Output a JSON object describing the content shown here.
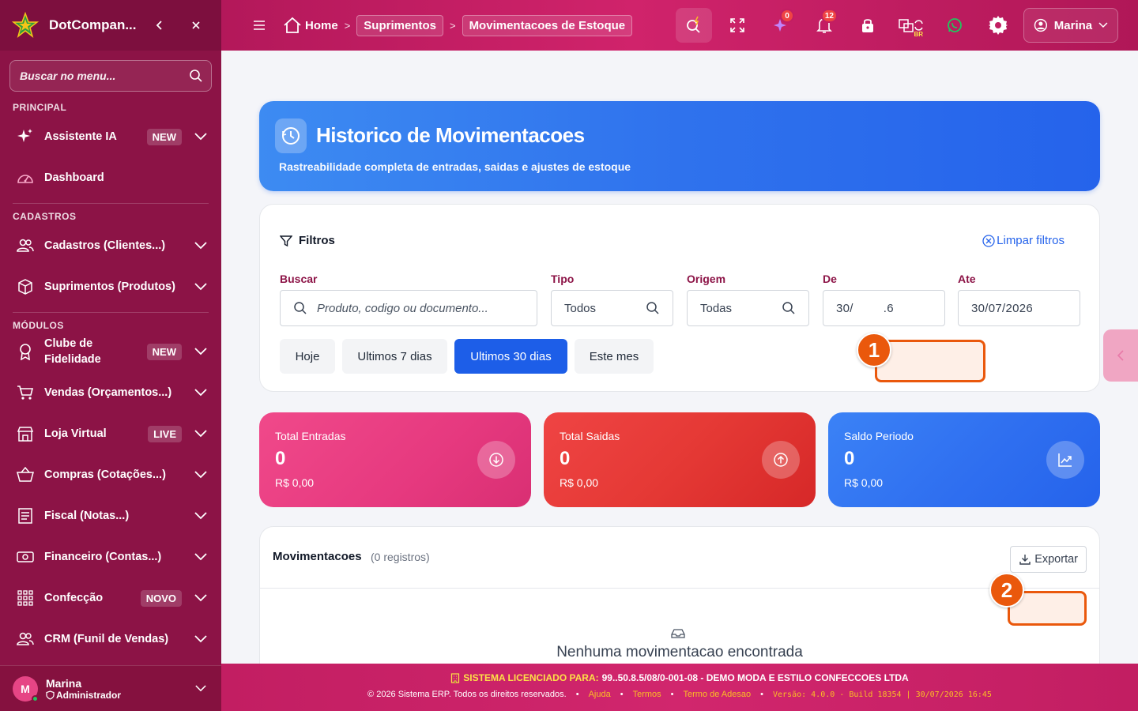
{
  "colors": {
    "sidebar": "#8c1346",
    "topbar": "#c21e62",
    "hero_blue": "#2f72ed",
    "stat_pink": "#e6397f",
    "stat_red": "#e53935",
    "stat_blue": "#2f6ff0",
    "accent_blue": "#2563eb",
    "callout_orange": "#ea580c"
  },
  "sidebar": {
    "brand": "DotCompan...",
    "search_placeholder": "Buscar no menu...",
    "sections": {
      "principal": "PRINCIPAL",
      "cadastros": "CADASTROS",
      "modulos": "MÓDULOS"
    },
    "items": {
      "assistente": {
        "label": "Assistente IA",
        "badge": "NEW"
      },
      "dashboard": {
        "label": "Dashboard"
      },
      "cadastros": {
        "label": "Cadastros (Clientes...)"
      },
      "suprimentos": {
        "label": "Suprimentos (Produtos)"
      },
      "clube_l1": "Clube de",
      "clube_l2": "Fidelidade",
      "clube_badge": "NEW",
      "vendas": {
        "label": "Vendas (Orçamentos...)"
      },
      "loja": {
        "label": "Loja Virtual",
        "badge": "LIVE"
      },
      "compras": {
        "label": "Compras (Cotações...)"
      },
      "fiscal": {
        "label": "Fiscal (Notas...)"
      },
      "financeiro": {
        "label": "Financeiro (Contas...)"
      },
      "confeccao": {
        "label": "Confecção",
        "badge": "NOVO"
      },
      "crm": {
        "label": "CRM (Funil de Vendas)"
      }
    },
    "user": {
      "initial": "M",
      "name": "Marina",
      "role": "Administrador"
    }
  },
  "topbar": {
    "breadcrumb": {
      "home": "Home",
      "level1": "Suprimentos",
      "current": "Movimentacoes de Estoque"
    },
    "badges": {
      "ai": "0",
      "notifications": "12"
    },
    "lang_tag": "BR",
    "user_name": "Marina"
  },
  "hero": {
    "title": "Historico de Movimentacoes",
    "subtitle": "Rastreabilidade completa de entradas, saidas e ajustes de estoque"
  },
  "filters": {
    "title": "Filtros",
    "clear": "Limpar filtros",
    "buscar": {
      "label": "Buscar",
      "placeholder": "Produto, codigo ou documento..."
    },
    "tipo": {
      "label": "Tipo",
      "value": "Todos"
    },
    "origem": {
      "label": "Origem",
      "value": "Todas"
    },
    "de": {
      "label": "De",
      "value_start": "30/",
      "value_end": ".6"
    },
    "ate": {
      "label": "Ate",
      "value": "30/07/2026"
    },
    "quick": [
      "Hoje",
      "Ultimos 7 dias",
      "Ultimos 30 dias",
      "Este mes"
    ],
    "quick_active": "Ultimos 30 dias"
  },
  "stats": {
    "entradas": {
      "label": "Total Entradas",
      "value": "0",
      "money": "R$ 0,00"
    },
    "saidas": {
      "label": "Total Saidas",
      "value": "0",
      "money": "R$ 0,00"
    },
    "saldo": {
      "label": "Saldo Periodo",
      "value": "0",
      "money": "R$ 0,00"
    }
  },
  "movements": {
    "title": "Movimentacoes",
    "count": "(0 registros)",
    "export": "Exportar",
    "empty": "Nenhuma movimentacao encontrada"
  },
  "callouts": {
    "one": "1",
    "two": "2"
  },
  "footer": {
    "license_label": "SISTEMA LICENCIADO PARA:",
    "license_value": "99..50.8.5/08/0-001-08 - DEMO MODA E ESTILO CONFECCOES LTDA",
    "copyright": "© 2026 Sistema ERP. Todos os direitos reservados.",
    "links": [
      "Ajuda",
      "Termos",
      "Termo de Adesao"
    ],
    "version": "Versão: 4.0.0 - Build 18354 | 30/07/2026 16:45"
  }
}
